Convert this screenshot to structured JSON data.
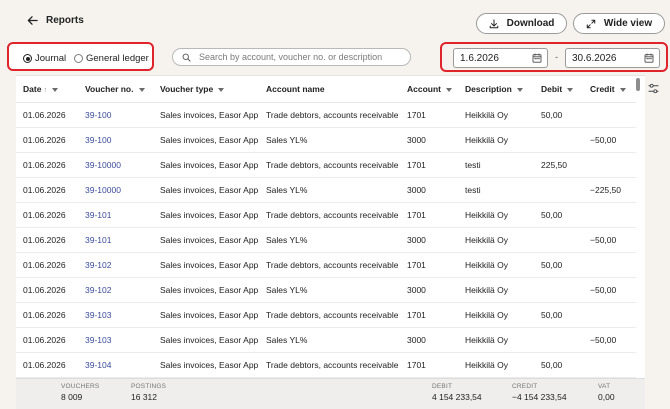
{
  "header": {
    "back_label": "Reports",
    "download_label": "Download",
    "wide_view_label": "Wide view"
  },
  "filters": {
    "radio_journal": "Journal",
    "radio_general_ledger": "General ledger",
    "selected": "Journal",
    "search_placeholder": "Search by account, voucher no. or description",
    "date_from": "1.6.2026",
    "date_separator": "-",
    "date_to": "30.6.2026"
  },
  "columns": [
    "Date",
    "Voucher no.",
    "Voucher type",
    "Account name",
    "Account",
    "Description",
    "Debit",
    "Credit"
  ],
  "sort_indicator": "↑",
  "rows": [
    {
      "date": "01.06.2026",
      "voucher": "39-100",
      "type": "Sales invoices, Easor App",
      "account_name": "Trade debtors, accounts receivable",
      "account": "1701",
      "description": "Heikkilä Oy",
      "debit": "50,00",
      "credit": ""
    },
    {
      "date": "01.06.2026",
      "voucher": "39-100",
      "type": "Sales invoices, Easor App",
      "account_name": "Sales YL%",
      "account": "3000",
      "description": "Heikkilä Oy",
      "debit": "",
      "credit": "−50,00"
    },
    {
      "date": "01.06.2026",
      "voucher": "39-10000",
      "type": "Sales invoices, Easor App",
      "account_name": "Trade debtors, accounts receivable",
      "account": "1701",
      "description": "testi",
      "debit": "225,50",
      "credit": ""
    },
    {
      "date": "01.06.2026",
      "voucher": "39-10000",
      "type": "Sales invoices, Easor App",
      "account_name": "Sales YL%",
      "account": "3000",
      "description": "testi",
      "debit": "",
      "credit": "−225,50"
    },
    {
      "date": "01.06.2026",
      "voucher": "39-101",
      "type": "Sales invoices, Easor App",
      "account_name": "Trade debtors, accounts receivable",
      "account": "1701",
      "description": "Heikkilä Oy",
      "debit": "50,00",
      "credit": ""
    },
    {
      "date": "01.06.2026",
      "voucher": "39-101",
      "type": "Sales invoices, Easor App",
      "account_name": "Sales YL%",
      "account": "3000",
      "description": "Heikkilä Oy",
      "debit": "",
      "credit": "−50,00"
    },
    {
      "date": "01.06.2026",
      "voucher": "39-102",
      "type": "Sales invoices, Easor App",
      "account_name": "Trade debtors, accounts receivable",
      "account": "1701",
      "description": "Heikkilä Oy",
      "debit": "50,00",
      "credit": ""
    },
    {
      "date": "01.06.2026",
      "voucher": "39-102",
      "type": "Sales invoices, Easor App",
      "account_name": "Sales YL%",
      "account": "3000",
      "description": "Heikkilä Oy",
      "debit": "",
      "credit": "−50,00"
    },
    {
      "date": "01.06.2026",
      "voucher": "39-103",
      "type": "Sales invoices, Easor App",
      "account_name": "Trade debtors, accounts receivable",
      "account": "1701",
      "description": "Heikkilä Oy",
      "debit": "50,00",
      "credit": ""
    },
    {
      "date": "01.06.2026",
      "voucher": "39-103",
      "type": "Sales invoices, Easor App",
      "account_name": "Sales YL%",
      "account": "3000",
      "description": "Heikkilä Oy",
      "debit": "",
      "credit": "−50,00"
    },
    {
      "date": "01.06.2026",
      "voucher": "39-104",
      "type": "Sales invoices, Easor App",
      "account_name": "Trade debtors, accounts receivable",
      "account": "1701",
      "description": "Heikkilä Oy",
      "debit": "50,00",
      "credit": ""
    }
  ],
  "footer": {
    "vouchers_label": "VOUCHERS",
    "vouchers_value": "8 009",
    "postings_label": "POSTINGS",
    "postings_value": "16 312",
    "debit_label": "DEBIT",
    "debit_value": "4 154 233,54",
    "credit_label": "CREDIT",
    "credit_value": "−4 154 233,54",
    "vat_label": "VAT",
    "vat_value": "0,00"
  },
  "icons": {
    "back": "arrow-left-icon",
    "download": "download-icon",
    "wide_view": "expand-icon",
    "search": "search-icon",
    "calendar": "calendar-icon",
    "settings": "column-settings-icon"
  },
  "colors": {
    "highlight_border": "#e0242c",
    "voucher_link": "#3b4b9a",
    "page_background": "#f6f3ee"
  }
}
